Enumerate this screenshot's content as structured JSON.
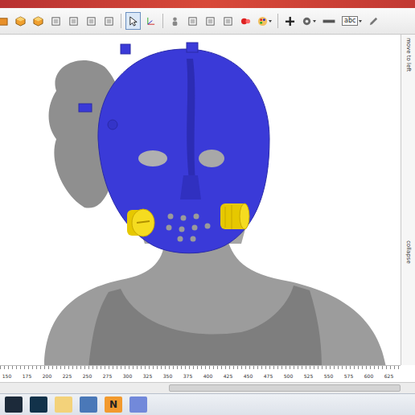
{
  "toolbar": {
    "items": [
      {
        "kind": "open",
        "selected": false,
        "has_menu": false
      },
      {
        "kind": "cube",
        "selected": false,
        "has_menu": false
      },
      {
        "kind": "cube",
        "selected": false,
        "has_menu": false
      },
      {
        "kind": "box",
        "selected": false,
        "has_menu": false
      },
      {
        "kind": "box",
        "selected": false,
        "has_menu": false
      },
      {
        "kind": "box",
        "selected": false,
        "has_menu": false
      },
      {
        "kind": "box",
        "selected": false,
        "has_menu": false
      },
      {
        "kind": "separator",
        "selected": false,
        "has_menu": false
      },
      {
        "kind": "cursor",
        "selected": true,
        "has_menu": false
      },
      {
        "kind": "axes",
        "selected": false,
        "has_menu": false
      },
      {
        "kind": "separator",
        "selected": false,
        "has_menu": false
      },
      {
        "kind": "figure",
        "selected": false,
        "has_menu": false
      },
      {
        "kind": "box",
        "selected": false,
        "has_menu": false
      },
      {
        "kind": "box",
        "selected": false,
        "has_menu": false
      },
      {
        "kind": "box",
        "selected": false,
        "has_menu": false
      },
      {
        "kind": "spheres",
        "selected": false,
        "has_menu": false
      },
      {
        "kind": "palette",
        "selected": false,
        "has_menu": true
      },
      {
        "kind": "separator",
        "selected": false,
        "has_menu": false
      },
      {
        "kind": "plus",
        "selected": false,
        "has_menu": false
      },
      {
        "kind": "gear",
        "selected": false,
        "has_menu": true
      },
      {
        "kind": "minus",
        "selected": false,
        "has_menu": false
      },
      {
        "kind": "label",
        "text": "abc",
        "selected": false,
        "has_menu": true
      },
      {
        "kind": "pencil",
        "selected": false,
        "has_menu": false
      }
    ]
  },
  "side_panel": {
    "labels": [
      "move to left",
      "collapse"
    ]
  },
  "ruler": {
    "ticks": [
      "150",
      "175",
      "200",
      "225",
      "250",
      "275",
      "300",
      "325",
      "350",
      "375",
      "400",
      "425",
      "450",
      "475",
      "500",
      "525",
      "550",
      "575",
      "600",
      "625"
    ]
  },
  "taskbar": {
    "items": [
      {
        "kind": "start"
      },
      {
        "kind": "cyan"
      },
      {
        "kind": "folder"
      },
      {
        "kind": "window"
      },
      {
        "kind": "letter",
        "label": "N"
      },
      {
        "kind": "discord"
      }
    ]
  }
}
